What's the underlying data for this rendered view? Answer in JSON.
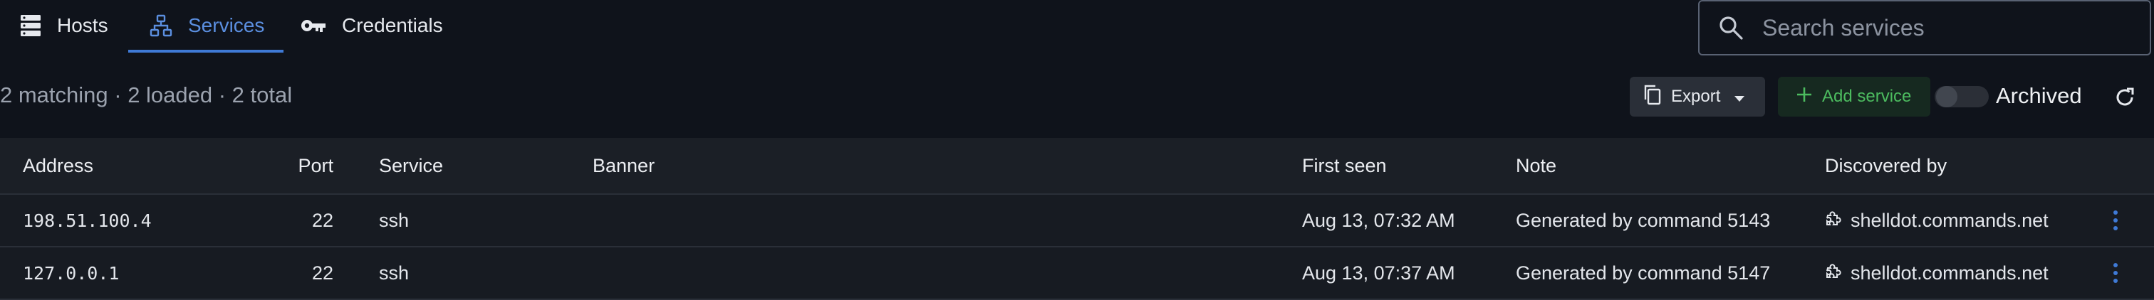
{
  "tabs": [
    {
      "label": "Hosts",
      "icon": "server-icon",
      "active": false
    },
    {
      "label": "Services",
      "icon": "network-icon",
      "active": true
    },
    {
      "label": "Credentials",
      "icon": "key-icon",
      "active": false
    }
  ],
  "search": {
    "placeholder": "Search services",
    "value": ""
  },
  "summary": "2 matching · 2 loaded · 2 total",
  "toolbar": {
    "export_label": "Export",
    "add_service_label": "Add service",
    "archived_label": "Archived",
    "archived_on": false
  },
  "table": {
    "columns": [
      "Address",
      "Port",
      "Service",
      "Banner",
      "First seen",
      "Note",
      "Discovered by"
    ],
    "rows": [
      {
        "address": "198.51.100.4",
        "port": "22",
        "service": "ssh",
        "banner": "",
        "first_seen": "Aug 13, 07:32 AM",
        "note": "Generated by command 5143",
        "discovered_by": "shelldot.commands.net"
      },
      {
        "address": "127.0.0.1",
        "port": "22",
        "service": "ssh",
        "banner": "",
        "first_seen": "Aug 13, 07:37 AM",
        "note": "Generated by command 5147",
        "discovered_by": "shelldot.commands.net"
      }
    ]
  },
  "colors": {
    "accent": "#3f7ad6",
    "add_green": "#4cbb5f",
    "background": "#0f131b"
  }
}
